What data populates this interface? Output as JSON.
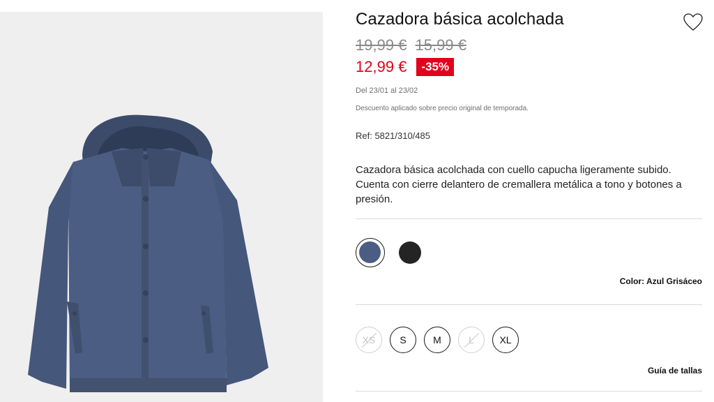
{
  "product": {
    "title": "Cazadora básica acolchada",
    "old_prices": [
      "19,99 €",
      "15,99 €"
    ],
    "price": "12,99 €",
    "discount": "-35%",
    "dates": "Del 23/01 al 23/02",
    "discount_note": "Descuento aplicado sobre precio original de temporada.",
    "ref": "Ref: 5821/310/485",
    "description": "Cazadora básica acolchada con cuello capucha ligeramente subido. Cuenta con cierre delantero de cremallera metálica a tono y botones a presión."
  },
  "colors": {
    "options": [
      {
        "name": "Azul Grisáceo",
        "hex": "#4b5d82",
        "selected": true
      },
      {
        "name": "Negro",
        "hex": "#242424",
        "selected": false
      }
    ],
    "selected_label": "Color: Azul Grisáceo"
  },
  "sizes": {
    "options": [
      {
        "label": "XS",
        "available": false
      },
      {
        "label": "S",
        "available": true
      },
      {
        "label": "M",
        "available": true
      },
      {
        "label": "L",
        "available": false
      },
      {
        "label": "XL",
        "available": true
      }
    ],
    "guide_label": "Guía de tallas"
  },
  "icons": {
    "wishlist": "heart-outline-icon"
  },
  "theme": {
    "sale_red": "#e2001a",
    "jacket_blue": "#4b5d82"
  }
}
